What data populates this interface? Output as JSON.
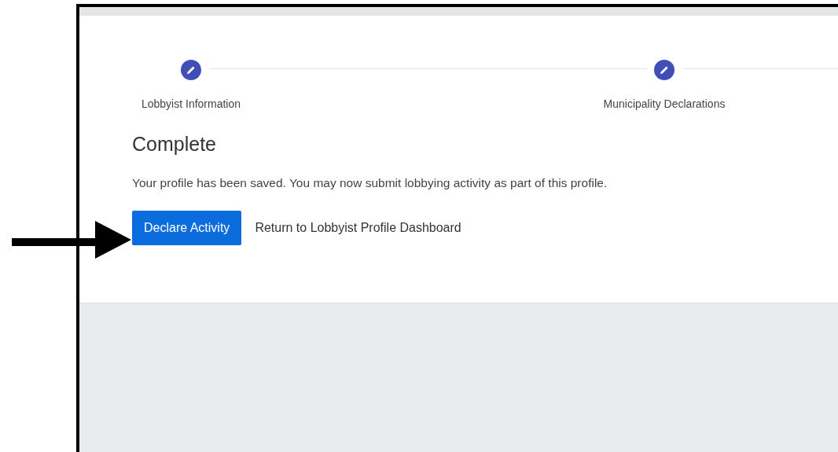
{
  "steps": [
    {
      "label": "Lobbyist Information"
    },
    {
      "label": "Municipality Declarations"
    }
  ],
  "heading": "Complete",
  "message": "Your profile has been saved. You may now submit lobbying activity as part of this profile.",
  "primary_button": "Declare Activity",
  "link": "Return to Lobbyist Profile Dashboard"
}
